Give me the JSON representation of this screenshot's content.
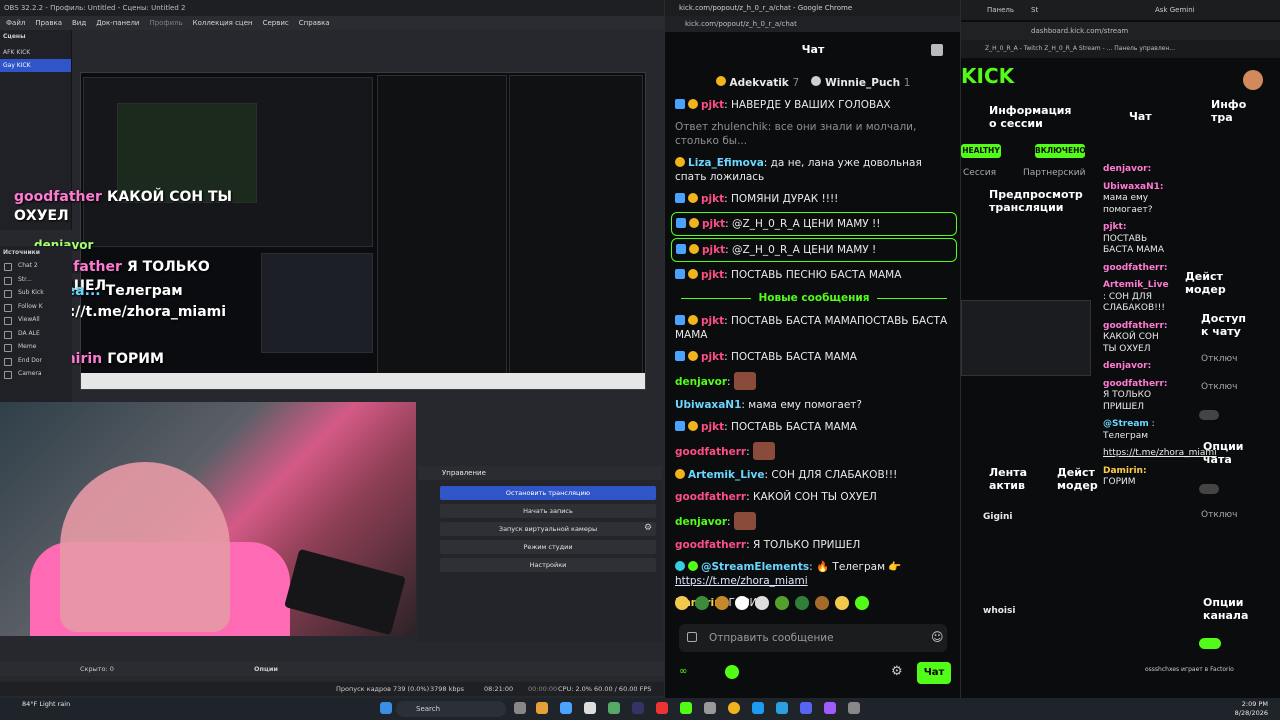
{
  "obs": {
    "title": "OBS 32.2.2 - Профиль: Untitled - Сцены: Untitled 2",
    "menu": [
      "Файл",
      "Правка",
      "Вид",
      "Док-панели",
      "Профиль",
      "Коллекция сцен",
      "Сервис",
      "Справка"
    ],
    "scenes_label": "Сцены",
    "scenes": [
      "AFK KICK",
      "Gay KICK"
    ],
    "sources_label": "Источники",
    "sources": [
      "Chat 2",
      "Str...",
      "Sub Kick",
      "Follow K",
      "ViewAll",
      "DA ALE",
      "Meme",
      "End Dor",
      "Camera"
    ],
    "overlay": {
      "lines": [
        {
          "name": "goodfather",
          "text": "КАКОЙ СОН ТЫ ОХУЕЛ"
        },
        {
          "name": "denjavor",
          "text": ""
        },
        {
          "name": "goodfather",
          "text": "Я ТОЛЬКО ПРИШЕЛ"
        },
        {
          "name": "@Strea...",
          "text": "Телеграм https://t.me/zhora_miami"
        },
        {
          "name": "Damirin",
          "text": "ГОРИМ"
        }
      ]
    },
    "controls": {
      "title": "Управление",
      "stop": "Остановить трансляцию",
      "record": "Начать запись",
      "vcam": "Запуск виртуальной камеры",
      "studio": "Режим студии",
      "settings": "Настройки"
    },
    "hidden": "Скрыто: 0",
    "options": "Опции",
    "status": {
      "dropped": "Пропуск кадров 739 (0.0%)",
      "kbps": "3798 kbps",
      "time": "08:21:00",
      "rec": "00:00:00",
      "cpu": "CPU: 2.0%",
      "fps": "60.00 / 60.00 FPS"
    }
  },
  "chat": {
    "window_title": "kick.com/popout/z_h_0_r_a/chat - Google Chrome",
    "url": "kick.com/popout/z_h_0_r_a/chat",
    "header": "Чат",
    "leaders": [
      {
        "name": "Adekvatik",
        "rank": "7"
      },
      {
        "name": "Winnie_Puch",
        "rank": "1"
      }
    ],
    "messages": [
      {
        "user": "pjkt",
        "text": "НАВЕРДЕ У ВАШИХ ГОЛОВАХ",
        "cls": "u-pink",
        "badges": [
          "b-sub",
          "b-gold"
        ],
        "hl": false
      },
      {
        "user": "",
        "text": "Ответ zhulenchik: все они знали и молчали, столько бы...",
        "cls": "u-cyan",
        "badges": [],
        "hl": false
      },
      {
        "user": "Liza_Efimova",
        "text": "да не, лана уже довольная спать ложилась",
        "cls": "u-cyan",
        "badges": [
          "b-gold"
        ],
        "hl": false
      },
      {
        "user": "pjkt",
        "text": "ПОМЯНИ ДУРАК !!!!",
        "cls": "u-pink",
        "badges": [
          "b-sub",
          "b-gold"
        ],
        "hl": false
      },
      {
        "user": "pjkt",
        "text": "@Z_H_0_R_A ЦЕНИ МАМУ !!",
        "cls": "u-pink",
        "badges": [
          "b-sub",
          "b-gold"
        ],
        "hl": true
      },
      {
        "user": "pjkt",
        "text": "@Z_H_0_R_A ЦЕНИ МАМУ !",
        "cls": "u-pink",
        "badges": [
          "b-sub",
          "b-gold"
        ],
        "hl": true
      },
      {
        "user": "pjkt",
        "text": "ПОСТАВЬ ПЕСНЮ БАСТА МАМА",
        "cls": "u-pink",
        "badges": [
          "b-sub",
          "b-gold"
        ],
        "hl": false
      }
    ],
    "new_label": "Новые сообщения",
    "new_messages": [
      {
        "user": "pjkt",
        "text": "ПОСТАВЬ БАСТА МАМАПОСТАВЬ БАСТА МАМА",
        "cls": "u-pink",
        "badges": [
          "b-sub",
          "b-gold"
        ]
      },
      {
        "user": "pjkt",
        "text": "ПОСТАВЬ БАСТА МАМА",
        "cls": "u-pink",
        "badges": [
          "b-sub",
          "b-gold"
        ]
      },
      {
        "user": "denjavor",
        "text": "",
        "cls": "u-green",
        "badges": [],
        "emote": true
      },
      {
        "user": "UbiwaxaN1",
        "text": "мама ему помогает?",
        "cls": "u-cyan",
        "badges": []
      },
      {
        "user": "pjkt",
        "text": "ПОСТАВЬ БАСТА МАМА",
        "cls": "u-pink",
        "badges": [
          "b-sub",
          "b-gold"
        ]
      },
      {
        "user": "goodfatherr",
        "text": "",
        "cls": "u-pink",
        "badges": [],
        "emote": true
      },
      {
        "user": "Artemik_Live",
        "text": "СОН ДЛЯ СЛАБАКОВ!!!",
        "cls": "u-cyan",
        "badges": [
          "b-gold"
        ]
      },
      {
        "user": "goodfatherr",
        "text": "КАКОЙ СОН ТЫ ОХУЕЛ",
        "cls": "u-pink",
        "badges": []
      },
      {
        "user": "denjavor",
        "text": "",
        "cls": "u-green",
        "badges": [],
        "emote": true
      },
      {
        "user": "goodfatherr",
        "text": "Я ТОЛЬКО ПРИШЕЛ",
        "cls": "u-pink",
        "badges": []
      },
      {
        "user": "@StreamElements",
        "text": "🔥 Телеграм 👉",
        "link": "https://t.me/zhora_miami",
        "cls": "u-cyan",
        "badges": [
          "b-bot",
          "b-green"
        ]
      },
      {
        "user": "Damirin",
        "text": "ГОРИМ",
        "cls": "u-gold",
        "badges": []
      }
    ],
    "input_placeholder": "Отправить сообщение",
    "send": "Чат"
  },
  "dash": {
    "tab1": "Панель",
    "tab2": "St",
    "tab3": "Ask Gemini",
    "url": "dashboard.kick.com/stream",
    "bookmarks": "Z_H_0_R_A - Twitch   Z_H_0_R_A Stream - ...   Панель управлен...",
    "logo": "KICK",
    "session_title": "Информация о сессии",
    "healthy": "HEALTHY",
    "enabled": "ВКЛЮЧЕНО",
    "session": "Сессия",
    "partner": "Партнерский",
    "chat_title": "Чат",
    "info_title": "Инфо тра",
    "preview_title": "Предпросмотр трансляции",
    "feed_title": "Лента актив",
    "mod_title": "Дейст модер",
    "access_title": "Доступ к чату",
    "chat_options": "Опции чата",
    "channel_options": "Опции канала",
    "off": "Отключ",
    "dchat": [
      {
        "u": "denjavor:",
        "t": ""
      },
      {
        "u": "UbiwaxaN1:",
        "t": "мама ему помогает?"
      },
      {
        "u": "pjkt:",
        "t": "ПОСТАВЬ БАСТА МАМА"
      },
      {
        "u": "goodfatherr:",
        "t": ""
      },
      {
        "u": "Artemik_Live",
        "t": ": СОН ДЛЯ СЛАБАКОВ!!!"
      },
      {
        "u": "goodfatherr:",
        "t": "КАКОЙ СОН ТЫ ОХУЕЛ"
      },
      {
        "u": "denjavor:",
        "t": ""
      },
      {
        "u": "goodfatherr:",
        "t": "Я ТОЛЬКО ПРИШЕЛ"
      },
      {
        "u": "@Stream",
        "t": ": Телеграм"
      },
      {
        "u": "",
        "t": "https://t.me/zhora_miami"
      },
      {
        "u": "Damirin:",
        "t": "ГОРИМ"
      }
    ],
    "feed": [
      "Gigini",
      "whoisi"
    ],
    "notif": "ossshchxes играет в Factorio"
  },
  "taskbar": {
    "weather": "84°F Light rain",
    "search": "Search",
    "time": "2:09 PM",
    "date": "8/28/2026"
  }
}
